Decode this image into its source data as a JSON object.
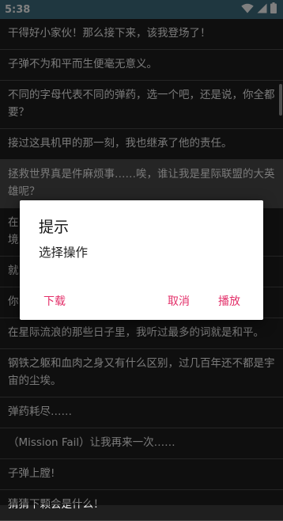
{
  "status_bar": {
    "time": "5:38",
    "icons": [
      "wifi-icon",
      "signal-icon",
      "battery-icon"
    ],
    "background": "#3f6f80"
  },
  "list": {
    "items": [
      "干得好小家伙！那么接下来，该我登场了！",
      "子弹不为和平而生便毫无意义。",
      "不同的字母代表不同的弹药，选一个吧，还是说，你全都要？",
      "接过这具机甲的那一刻，我也继承了他的责任。",
      "拯救世界真是件麻烦事……唉，谁让我是星际联盟的大英雄呢？",
      "在\n境",
      "就",
      "你",
      "在星际流浪的那些日子里，我听过最多的词就是和平。",
      "钢铁之躯和血肉之身又有什么区别，过几百年还不都是宇宙的尘埃。",
      "弹药耗尽……",
      "（Mission Fail）让我再来一次……",
      "子弹上膛!",
      "猜猜下颗会是什么！"
    ],
    "selected_index": 4
  },
  "dialog": {
    "title": "提示",
    "message": "选择操作",
    "buttons": {
      "download": "下载",
      "cancel": "取消",
      "play": "播放"
    },
    "accent_color": "#e3306a"
  }
}
